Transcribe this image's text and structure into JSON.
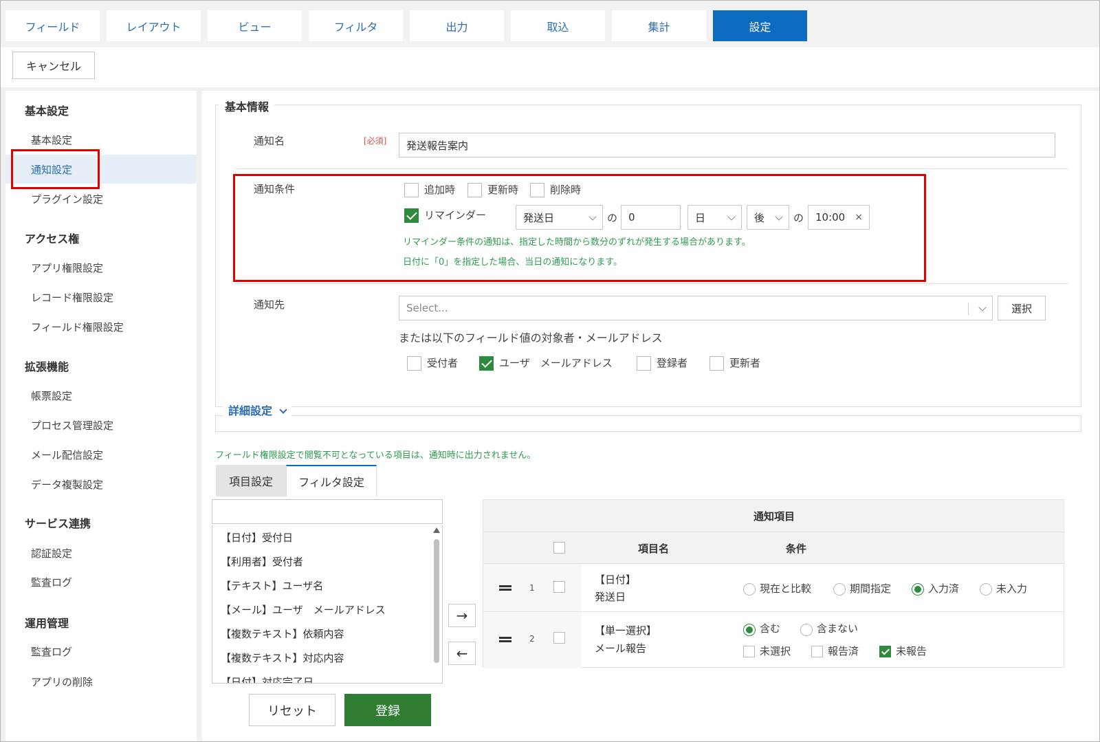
{
  "tabs": [
    "フィールド",
    "レイアウト",
    "ビュー",
    "フィルタ",
    "出力",
    "取込",
    "集計",
    "設定"
  ],
  "toolbar": {
    "cancel": "キャンセル"
  },
  "sidebar": {
    "h1": "基本設定",
    "i_basic": "基本設定",
    "i_notify": "通知設定",
    "i_plugin": "プラグイン設定",
    "h2": "アクセス権",
    "i_app_perm": "アプリ権限設定",
    "i_rec_perm": "レコード権限設定",
    "i_field_perm": "フィールド権限設定",
    "h3": "拡張機能",
    "i_form": "帳票設定",
    "i_process": "プロセス管理設定",
    "i_mail": "メール配信設定",
    "i_copy": "データ複製設定",
    "h4": "サービス連携",
    "i_auth": "認証設定",
    "i_audit": "監査ログ",
    "h5": "運用管理",
    "i_audit2": "監査ログ",
    "i_delete": "アプリの削除"
  },
  "basic": {
    "legend": "基本情報",
    "name_label": "通知名",
    "required": "[必須]",
    "name_value": "発送報告案内",
    "cond_label": "通知条件",
    "cb_add": "追加時",
    "cb_update": "更新時",
    "cb_delete": "削除時",
    "cb_reminder": "リマインダー",
    "rem_field": "発送日",
    "no1": "の",
    "rem_num": "0",
    "rem_unit": "日",
    "rem_dir": "後",
    "no2": "の",
    "rem_time": "10:00",
    "clear": "×",
    "note1": "リマインダー条件の通知は、指定した時間から数分のずれが発生する場合があります。",
    "note2": "日付に「0」を指定した場合、当日の通知になります。",
    "dest_label": "通知先",
    "select_ph": "Select...",
    "select_btn": "選択",
    "or_text": "または以下のフィールド値の対象者・メールアドレス",
    "cb_receiver": "受付者",
    "cb_user_mail": "ユーザ　メールアドレス",
    "cb_registrant": "登録者",
    "cb_updater": "更新者"
  },
  "detail": {
    "legend": "詳細設定"
  },
  "field_note": "フィールド権限設定で閲覧不可となっている項目は、通知時に出力されません。",
  "subtabs": [
    "項目設定",
    "フィルタ設定"
  ],
  "list": [
    "【日付】受付日",
    "【利用者】受付者",
    "【テキスト】ユーザ名",
    "【メール】ユーザ　メールアドレス",
    "【複数テキスト】依頼内容",
    "【複数テキスト】対応内容",
    "【日付】対応完了日"
  ],
  "table": {
    "title": "通知項目",
    "col_name": "項目名",
    "col_cond": "条件",
    "r1_num": "1",
    "r1_type": "【日付】",
    "r1_name": "発送日",
    "r1_opts": [
      "現在と比較",
      "期間指定",
      "入力済",
      "未入力"
    ],
    "r2_num": "2",
    "r2_type": "【単一選択】",
    "r2_name": "メール報告",
    "r2_radios": [
      "含む",
      "含まない"
    ],
    "r2_checks": [
      "未選択",
      "報告済",
      "未報告"
    ]
  },
  "arrows": {
    "right": "→",
    "left": "←"
  },
  "buttons": {
    "reset": "リセット",
    "submit": "登録"
  }
}
